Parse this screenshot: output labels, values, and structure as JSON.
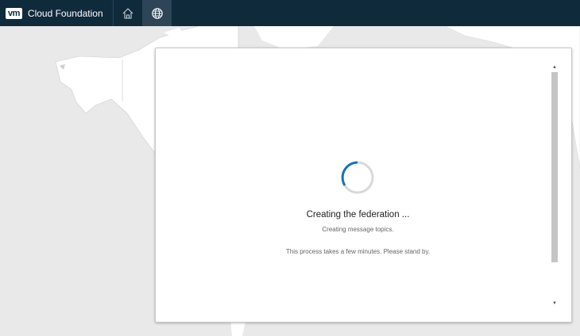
{
  "header": {
    "logo": "vm",
    "title": "Cloud Foundation",
    "nav": [
      {
        "icon": "home-icon"
      },
      {
        "icon": "globe-icon",
        "active": true
      }
    ]
  },
  "dialog": {
    "title": "Creating the federation ...",
    "status": "Creating message topics.",
    "note": "This process takes a few minutes. Please stand by."
  },
  "colors": {
    "header_bg": "#0f2a3b",
    "spinner_accent": "#1a73b8",
    "spinner_track": "#d9d9d9",
    "map_land": "#ffffff",
    "map_water": "#e9e9e9"
  }
}
